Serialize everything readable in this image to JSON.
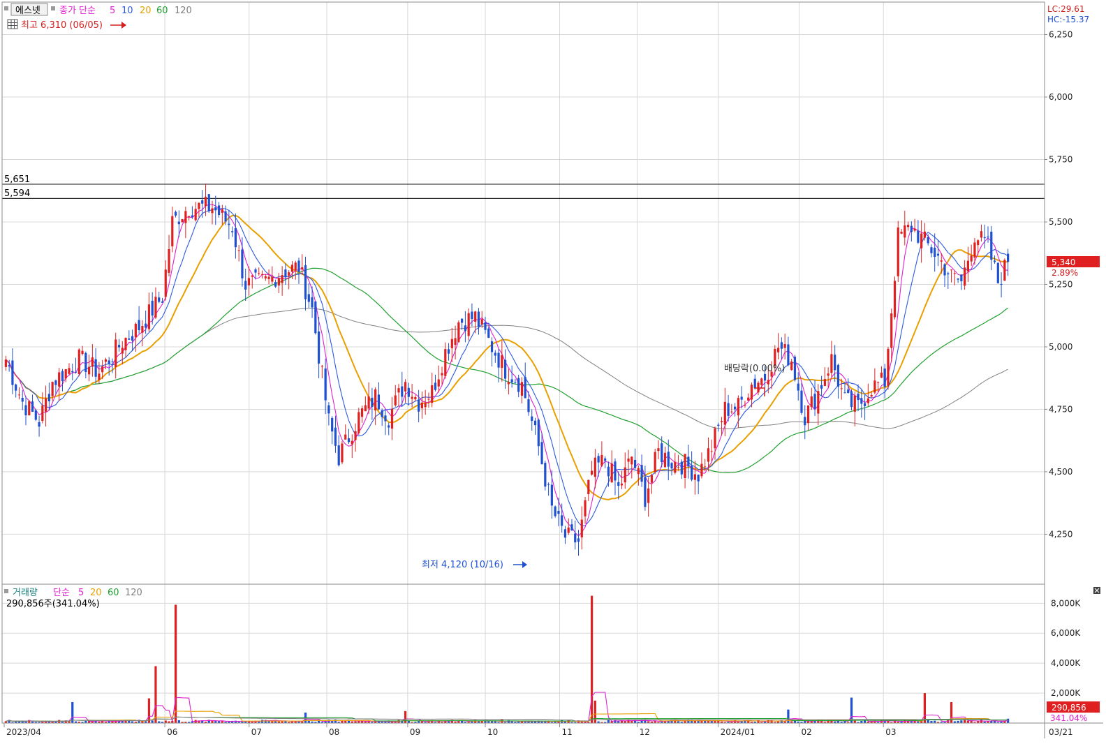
{
  "header": {
    "stock_name": "에스넷",
    "price_ma": {
      "label": "종가 단순",
      "periods": [
        {
          "text": "5",
          "color": "#e020d0"
        },
        {
          "text": "10",
          "color": "#2a5ae0"
        },
        {
          "text": "20",
          "color": "#e8a000"
        },
        {
          "text": "60",
          "color": "#20a030"
        },
        {
          "text": "120",
          "color": "#808080"
        }
      ]
    },
    "high_text": "최고 6,310 (06/05)",
    "low_text": "최저 4,120 (10/16)",
    "dividend_text": "배당락(0.00%)",
    "lc_text": "LC:29.61",
    "hc_text": "HC:-15.37",
    "hline_labels": [
      "5,651",
      "5,594"
    ],
    "current_price": "5,340",
    "current_change": "2.89%",
    "volume": {
      "label": "거래량",
      "ma_label": "단순",
      "periods": [
        {
          "text": "5",
          "color": "#e020d0"
        },
        {
          "text": "20",
          "color": "#e8a000"
        },
        {
          "text": "60",
          "color": "#20a030"
        },
        {
          "text": "120",
          "color": "#808080"
        }
      ],
      "summary": "290,856주(341.04%)",
      "current_value": "290,856",
      "current_pct": "341.04%"
    }
  },
  "colors": {
    "up": "#e02020",
    "down": "#1e50d0",
    "ma5": "#e020d0",
    "ma10": "#2a5ae0",
    "ma20": "#e8a000",
    "ma60": "#20a030",
    "ma120": "#808080",
    "grid": "#d8d8d8",
    "badge": "#e02020"
  },
  "chart_data": {
    "type": "candlestick",
    "price_axis": {
      "ticks": [
        4250,
        4500,
        4750,
        5000,
        5250,
        5500,
        5750,
        6000,
        6250
      ],
      "tick_labels": [
        "4,250",
        "4,500",
        "4,750",
        "5,000",
        "5,250",
        "5,500",
        "5,750",
        "6,000",
        "6,250"
      ],
      "range": [
        4050,
        6380
      ]
    },
    "volume_axis": {
      "ticks": [
        2000,
        4000,
        6000,
        8000
      ],
      "tick_labels": [
        "2,000K",
        "4,000K",
        "6,000K",
        "8,000K"
      ],
      "range": [
        0,
        8900
      ]
    },
    "x_axis_labels": [
      "2023/04",
      "06",
      "07",
      "08",
      "09",
      "10",
      "11",
      "12",
      "2024/01",
      "02",
      "03",
      "03/21"
    ],
    "horizontal_lines": [
      5651,
      5594
    ],
    "high": {
      "value": 6310,
      "date": "06/05"
    },
    "low": {
      "value": 4120,
      "date": "10/16"
    },
    "current": {
      "value": 5340,
      "change_pct": 2.89
    },
    "ohlc_keyframes": [
      [
        0,
        4950
      ],
      [
        5,
        4780
      ],
      [
        10,
        4700
      ],
      [
        14,
        4860
      ],
      [
        22,
        4950
      ],
      [
        28,
        4900
      ],
      [
        35,
        5020
      ],
      [
        40,
        5080
      ],
      [
        47,
        5200
      ],
      [
        50,
        5500
      ],
      [
        55,
        5560
      ],
      [
        62,
        5560
      ],
      [
        68,
        5480
      ],
      [
        72,
        5250
      ],
      [
        78,
        5260
      ],
      [
        83,
        5300
      ],
      [
        88,
        5320
      ],
      [
        92,
        5150
      ],
      [
        97,
        4700
      ],
      [
        100,
        4560
      ],
      [
        106,
        4720
      ],
      [
        111,
        4800
      ],
      [
        115,
        4720
      ],
      [
        120,
        4860
      ],
      [
        124,
        4780
      ],
      [
        128,
        4820
      ],
      [
        132,
        4980
      ],
      [
        136,
        5100
      ],
      [
        141,
        5120
      ],
      [
        146,
        5000
      ],
      [
        150,
        4910
      ],
      [
        155,
        4850
      ],
      [
        160,
        4600
      ],
      [
        164,
        4350
      ],
      [
        168,
        4240
      ],
      [
        172,
        4220
      ],
      [
        176,
        4500
      ],
      [
        180,
        4550
      ],
      [
        184,
        4430
      ],
      [
        188,
        4560
      ],
      [
        192,
        4400
      ],
      [
        196,
        4580
      ],
      [
        200,
        4540
      ],
      [
        204,
        4530
      ],
      [
        208,
        4490
      ],
      [
        212,
        4600
      ],
      [
        216,
        4750
      ],
      [
        220,
        4760
      ],
      [
        224,
        4850
      ],
      [
        228,
        4880
      ],
      [
        232,
        5000
      ],
      [
        236,
        4950
      ],
      [
        240,
        4720
      ],
      [
        244,
        4820
      ],
      [
        248,
        4950
      ],
      [
        252,
        4780
      ],
      [
        256,
        4760
      ],
      [
        260,
        4840
      ],
      [
        264,
        4860
      ],
      [
        268,
        5440
      ],
      [
        272,
        5480
      ],
      [
        276,
        5420
      ],
      [
        280,
        5360
      ],
      [
        284,
        5280
      ],
      [
        287,
        5260
      ],
      [
        291,
        5450
      ],
      [
        295,
        5400
      ],
      [
        298,
        5260
      ],
      [
        301,
        5340
      ]
    ],
    "volume_spikes": [
      {
        "day": 20,
        "value": 1400
      },
      {
        "day": 43,
        "value": 1650
      },
      {
        "day": 45,
        "value": 3800
      },
      {
        "day": 51,
        "value": 7900
      },
      {
        "day": 90,
        "value": 700
      },
      {
        "day": 120,
        "value": 800
      },
      {
        "day": 176,
        "value": 8500
      },
      {
        "day": 177,
        "value": 1500
      },
      {
        "day": 235,
        "value": 900
      },
      {
        "day": 254,
        "value": 1700
      },
      {
        "day": 276,
        "value": 2000
      },
      {
        "day": 284,
        "value": 1400
      },
      {
        "day": 301,
        "value": 290.856
      }
    ]
  }
}
